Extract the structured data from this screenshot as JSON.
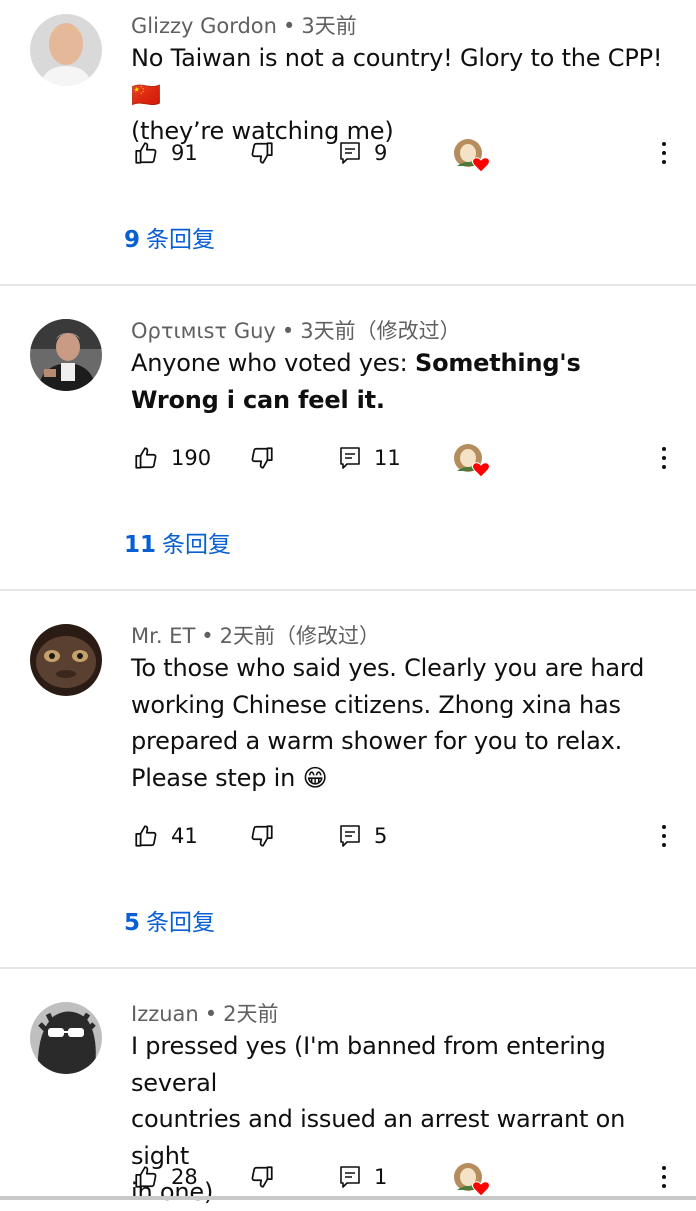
{
  "comments": [
    {
      "author": "Glizzy Gordon",
      "time": "3天前",
      "edited": "",
      "text_lines": [
        "No Taiwan is not a country! Glory to the CPP! 🇨🇳",
        "(they’re watching me)"
      ],
      "likes": "91",
      "replies_count": "9",
      "replies_link_num": "9",
      "replies_link_suffix": "条回复"
    },
    {
      "author": "Oρτιмιsτ Guy",
      "time": "3天前",
      "edited": "（修改过）",
      "text_plain": "Anyone who voted yes: ",
      "text_bold": "Something's Wrong i can feel it.",
      "likes": "190",
      "replies_count": "11",
      "replies_link_num": "11",
      "replies_link_suffix": "条回复"
    },
    {
      "author": "Mr. ET",
      "time": "2天前",
      "edited": "（修改过）",
      "text_lines": [
        "To those who said yes. Clearly you are hard",
        "working Chinese citizens. Zhong xina has",
        "prepared a warm shower for you to relax.",
        "Please step in 😁"
      ],
      "likes": "41",
      "replies_count": "5",
      "replies_link_num": "5",
      "replies_link_suffix": "条回复"
    },
    {
      "author": "Izzuan",
      "time": "2天前",
      "edited": "",
      "text_lines": [
        "I pressed yes (I'm banned from entering several",
        "countries and issued an arrest warrant on sight",
        "in one)"
      ],
      "likes": "28",
      "replies_count": "1"
    }
  ],
  "icons": {
    "like": "thumb-up-icon",
    "dislike": "thumb-down-icon",
    "reply": "reply-comment-icon",
    "creator_heart": "creator-heart-icon",
    "more": "more-vertical-icon"
  },
  "colors": {
    "link": "#065fd4",
    "meta": "#606060",
    "heart": "#ff0000",
    "divider": "#e5e5e5"
  }
}
